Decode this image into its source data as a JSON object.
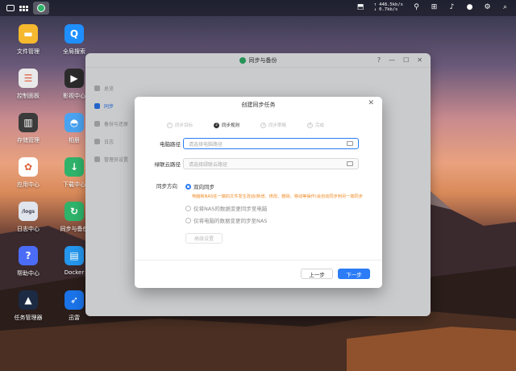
{
  "topbar": {
    "speed_up": "↑ 448.5kb/s",
    "speed_down": "↓ 0.7kb/s",
    "icons": [
      "network-speed-icon",
      "filter-icon",
      "grid-icon",
      "bell-icon",
      "user-icon",
      "gear-icon",
      "search-icon"
    ]
  },
  "desktop": {
    "icons": [
      {
        "label": "文件管理",
        "color": "#f5b82e",
        "name": "file-manager"
      },
      {
        "label": "全局搜索",
        "color": "#1f8fff",
        "name": "global-search"
      },
      {
        "label": "控制面板",
        "color": "#e9e9e9",
        "name": "control-panel"
      },
      {
        "label": "影视中心",
        "color": "#2b2b2b",
        "name": "video-center"
      },
      {
        "label": "存储管理",
        "color": "#3b3b3b",
        "name": "storage-manager"
      },
      {
        "label": "相册",
        "color": "#4aa3f0",
        "name": "photos"
      },
      {
        "label": "应用中心",
        "color": "#ffffff",
        "name": "app-center"
      },
      {
        "label": "下载中心",
        "color": "#2fb36a",
        "name": "download-center"
      },
      {
        "label": "日志中心",
        "color": "#e0e4ec",
        "name": "log-center"
      },
      {
        "label": "同步与备份",
        "color": "#2fb36a",
        "name": "sync-backup"
      },
      {
        "label": "帮助中心",
        "color": "#4b6cf6",
        "name": "help-center"
      },
      {
        "label": "Docker",
        "color": "#2496ed",
        "name": "docker"
      },
      {
        "label": "任务管理器",
        "color": "#1c2a44",
        "name": "task-manager"
      },
      {
        "label": "迅雷",
        "color": "#1a73e8",
        "name": "xunlei"
      }
    ],
    "logs_text": "/logs"
  },
  "window": {
    "title": "同步与备份",
    "sidebar": [
      {
        "label": "总览",
        "active": false
      },
      {
        "label": "同步",
        "active": true
      },
      {
        "label": "备份与还原",
        "active": false
      },
      {
        "label": "日志",
        "active": false
      },
      {
        "label": "管理员设置",
        "active": false
      }
    ]
  },
  "dialog": {
    "title": "创建同步任务",
    "steps": [
      {
        "num": "✓",
        "label": "同步目标",
        "state": "done"
      },
      {
        "num": "2",
        "label": "同步规则",
        "state": "active"
      },
      {
        "num": "3",
        "label": "同步策略",
        "state": "todo"
      },
      {
        "num": "4",
        "label": "完成",
        "state": "todo"
      }
    ],
    "local_path_label": "电脑路径",
    "local_path_placeholder": "请选择电脑路径",
    "cloud_path_label": "绿联云路径",
    "cloud_path_placeholder": "请选择绿联云路径",
    "sync_direction_label": "同步方向",
    "options": [
      {
        "label": "双向同步",
        "selected": true
      },
      {
        "label": "仅将NAS的数据变更同步至电脑",
        "selected": false
      },
      {
        "label": "仅将电脑的数据变更同步至NAS",
        "selected": false
      }
    ],
    "hint": "电脑和NAS任一端的文件发生改动(新增、修改、删除、移动等操作)会自动同步到另一端同步",
    "advanced_button": "高级设置",
    "prev_button": "上一步",
    "next_button": "下一步"
  },
  "colors": {
    "accent": "#2b7cf6",
    "hint": "#f08a24",
    "sync_green": "#2fb36a"
  }
}
